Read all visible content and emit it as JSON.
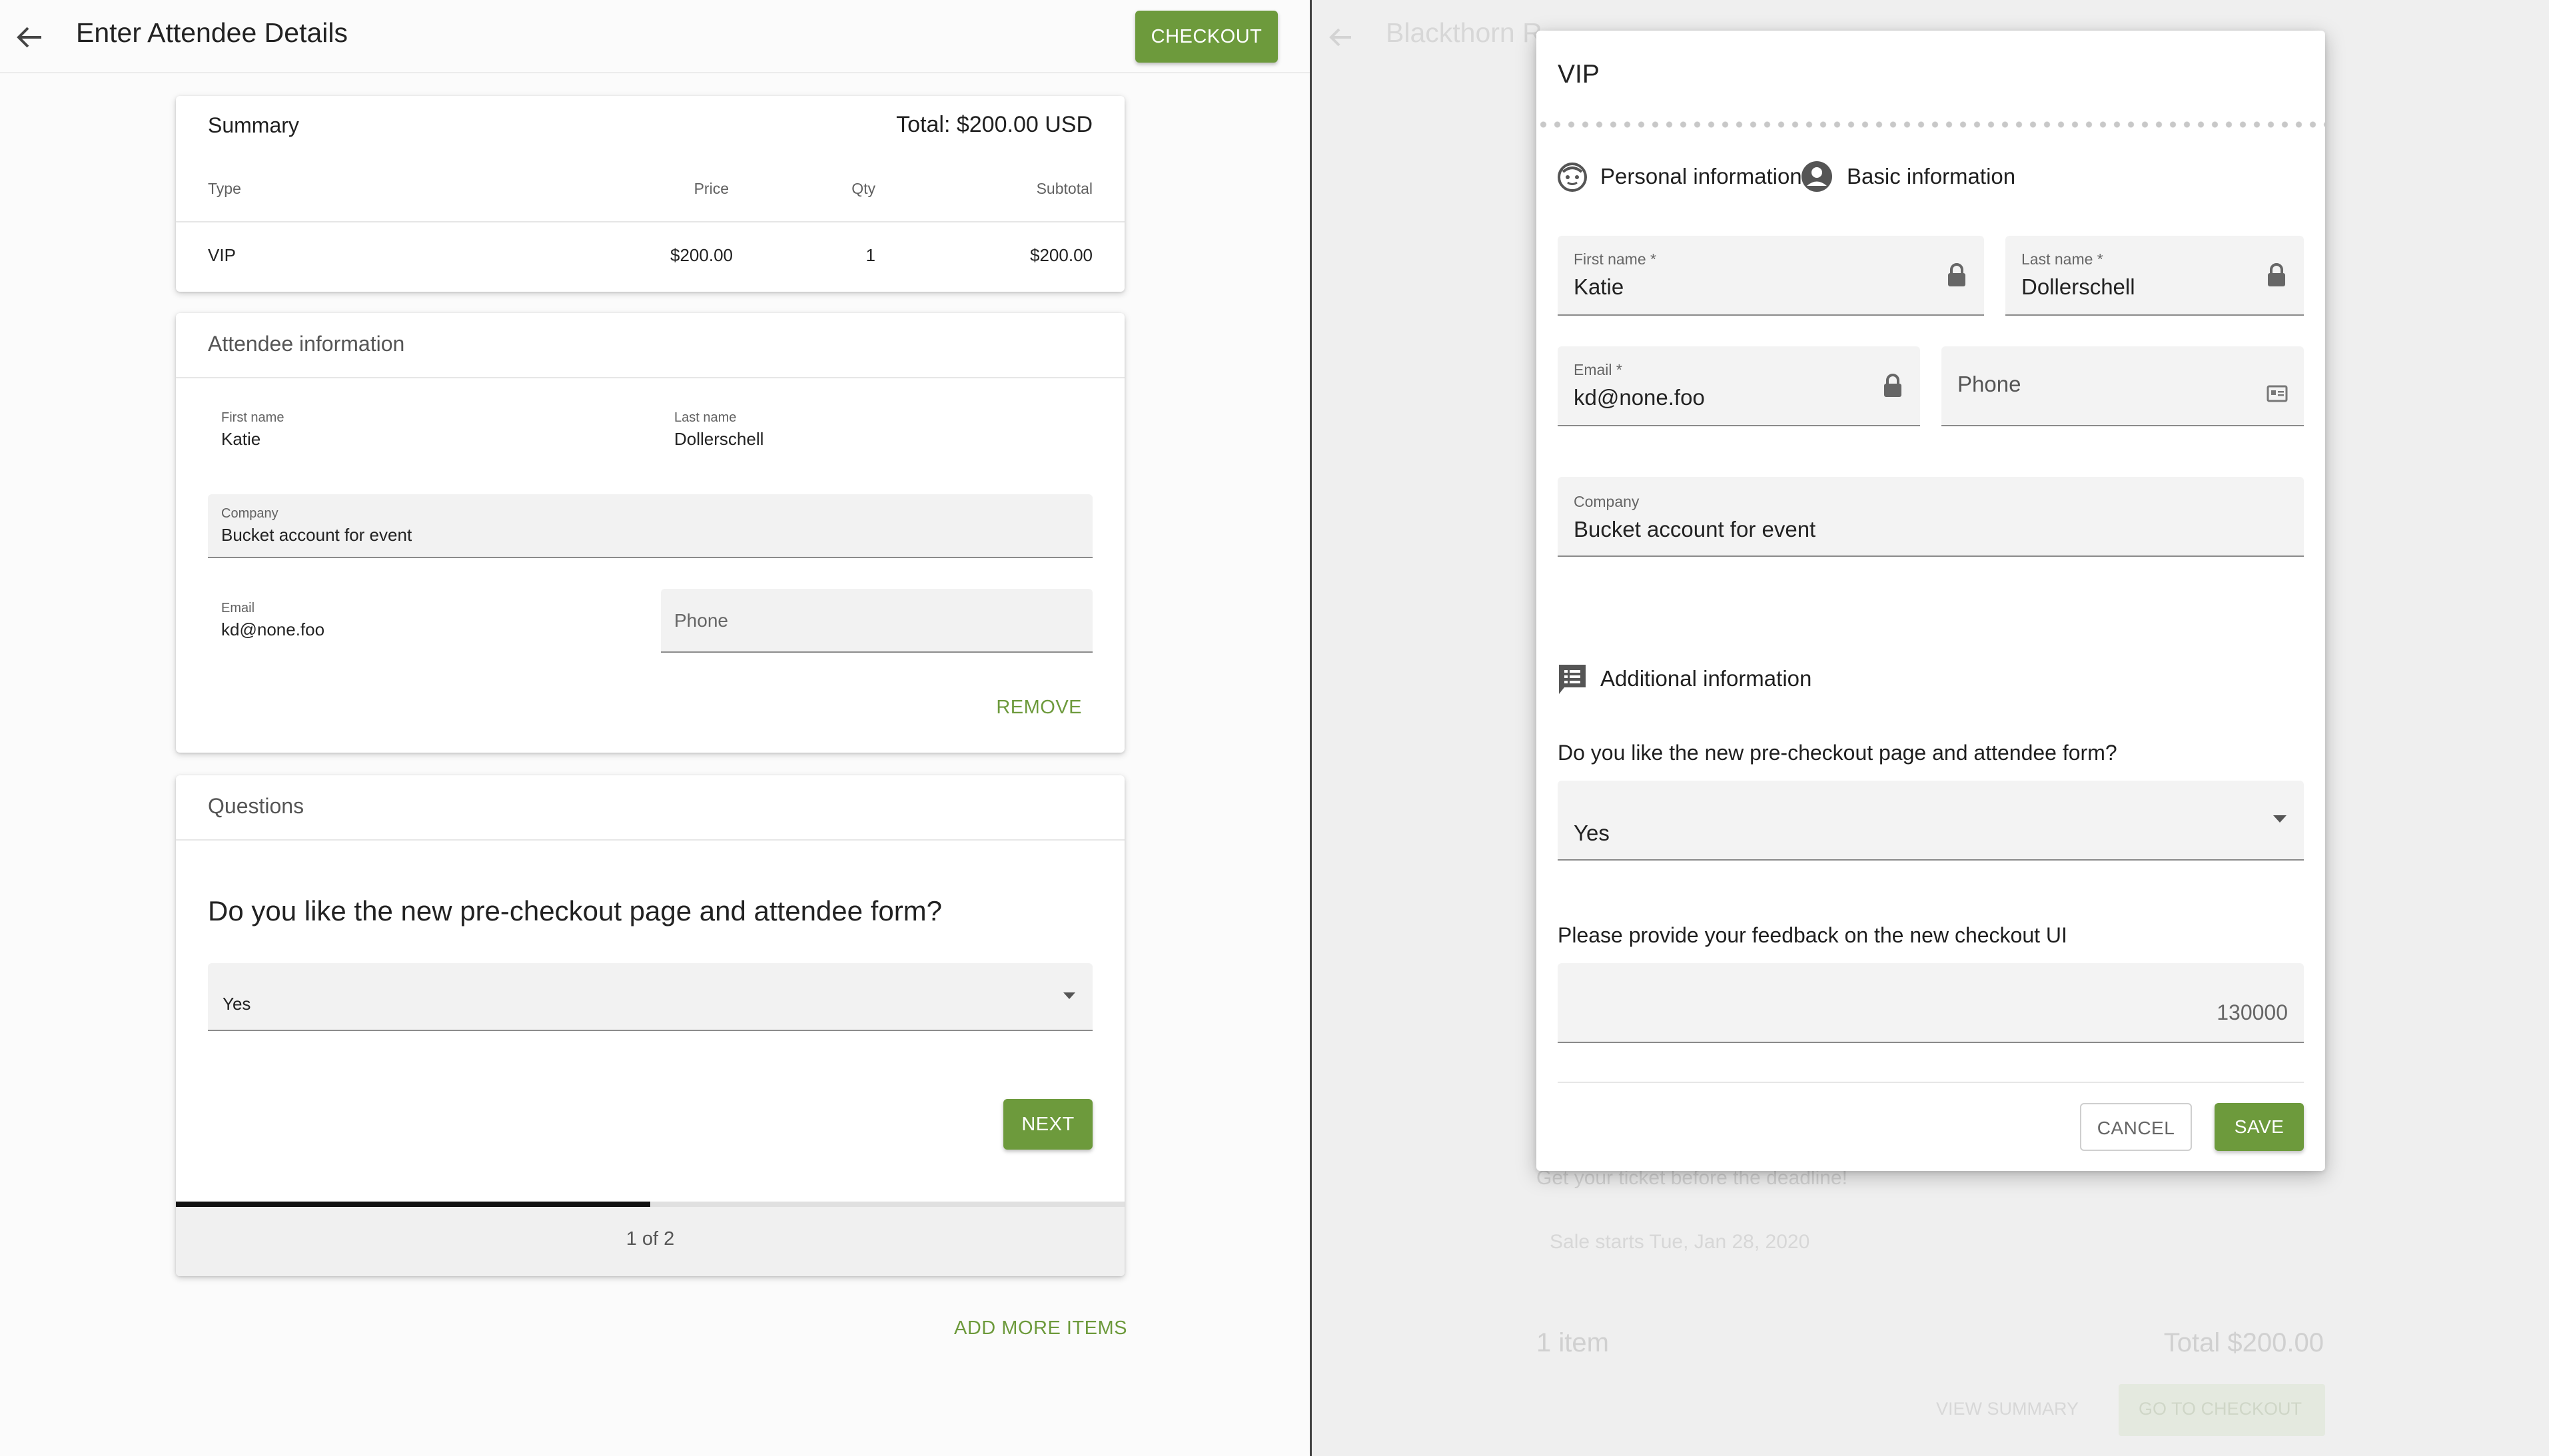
{
  "left": {
    "header": {
      "title": "Enter Attendee Details",
      "checkout_label": "CHECKOUT"
    },
    "summary": {
      "title": "Summary",
      "total": "Total: $200.00 USD",
      "columns": [
        "Type",
        "Price",
        "Qty",
        "Subtotal"
      ],
      "rows": [
        {
          "type": "VIP",
          "price": "$200.00",
          "qty": "1",
          "subtotal": "$200.00"
        }
      ]
    },
    "attendee": {
      "title": "Attendee information",
      "first_name_label": "First name",
      "first_name": "Katie",
      "last_name_label": "Last name",
      "last_name": "Dollerschell",
      "company_label": "Company",
      "company": "Bucket account for event",
      "email_label": "Email",
      "email": "kd@none.foo",
      "phone_placeholder": "Phone",
      "remove_label": "REMOVE"
    },
    "questions": {
      "title": "Questions",
      "question": "Do you like the new pre-checkout page and attendee form?",
      "answer": "Yes",
      "next_label": "NEXT",
      "progress": 0.5,
      "pager": "1 of 2"
    },
    "add_more_label": "ADD MORE ITEMS"
  },
  "background": {
    "title": "Blackthorn R",
    "deadline_text": "Get your ticket before the deadline!",
    "sale_text": "Sale starts Tue, Jan 28, 2020",
    "items": "1 item",
    "total": "Total  $200.00",
    "view_summary": "VIEW SUMMARY",
    "go_checkout": "GO TO CHECKOUT"
  },
  "modal": {
    "title": "VIP",
    "personal_info": "Personal information",
    "basic_info": "Basic information",
    "first_name_label": "First name *",
    "first_name": "Katie",
    "last_name_label": "Last name *",
    "last_name": "Dollerschell",
    "email_label": "Email *",
    "email": "kd@none.foo",
    "phone_placeholder": "Phone",
    "company_label": "Company",
    "company": "Bucket account for event",
    "additional_info": "Additional information",
    "question1": "Do you like the new pre-checkout page and attendee form?",
    "answer1": "Yes",
    "question2": "Please provide your feedback on the new checkout UI",
    "char_count": "130000",
    "cancel_label": "CANCEL",
    "save_label": "SAVE"
  },
  "colors": {
    "accent": "#6d9a3c",
    "overlay": "#efefef"
  }
}
